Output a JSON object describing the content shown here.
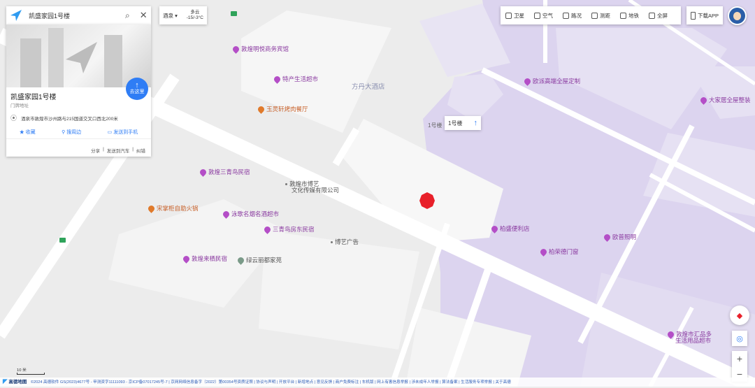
{
  "search": {
    "value": "凯盛家园1号楼"
  },
  "weather": {
    "city": "酒泉",
    "condition": "多云",
    "temp": "-15/-3°C"
  },
  "toolbar": {
    "items": [
      {
        "label": "卫星",
        "icon": "satellite-icon"
      },
      {
        "label": "空气",
        "icon": "air-icon"
      },
      {
        "label": "路况",
        "icon": "traffic-light-icon"
      },
      {
        "label": "测距",
        "icon": "ruler-icon"
      },
      {
        "label": "地铁",
        "icon": "subway-icon"
      },
      {
        "label": "全屏",
        "icon": "fullscreen-icon"
      }
    ],
    "download": "下载APP"
  },
  "place": {
    "name": "凯盛家园1号楼",
    "type": "门牌地址",
    "address": "酒泉市敦煌市沙州路与215国道交叉口西北200米",
    "go_label": "去这里",
    "actions": [
      "收藏",
      "搜周边",
      "发送到手机"
    ],
    "links": [
      "分享",
      "发送到汽车",
      "纠错"
    ]
  },
  "marker_label": "1号楼",
  "building_label": "1号楼",
  "pois": [
    {
      "name": "敦煌明悦商务宾馆",
      "kind": "purple"
    },
    {
      "name": "特产生活超市",
      "kind": "purple"
    },
    {
      "name": "玉灵轩烤肉餐厅",
      "kind": "orange"
    },
    {
      "name": "欧派高端全屋定制",
      "kind": "purple"
    },
    {
      "name": "大家居全屋整装",
      "kind": "purple"
    },
    {
      "name": "敦煌三青鸟民宿",
      "kind": "purple"
    },
    {
      "name": "敦煌市博艺",
      "kind": "dot"
    },
    {
      "name": "文化传媒有限公司",
      "kind": "text"
    },
    {
      "name": "宋掌柜自助火锅",
      "kind": "orange"
    },
    {
      "name": "泳歌名烟名酒超市",
      "kind": "purple"
    },
    {
      "name": "三青鸟房东民宿",
      "kind": "purple"
    },
    {
      "name": "博艺广告",
      "kind": "dot"
    },
    {
      "name": "柏盛便利店",
      "kind": "purple"
    },
    {
      "name": "欧普照明",
      "kind": "purple"
    },
    {
      "name": "柏荣德门窗",
      "kind": "purple"
    },
    {
      "name": "敦煌来栖民宿",
      "kind": "purple"
    },
    {
      "name": "绿云丽都家苑",
      "kind": "gray"
    },
    {
      "name": "敦煌市汇品多",
      "kind": "purple"
    },
    {
      "name": "生活用品超市",
      "kind": "text"
    }
  ],
  "area_label": "方丹大酒店",
  "scale": "10 米",
  "logo": "高德地图",
  "copyright": "©2024 高德软件 GS(2023)4677号 - 甲测资字11111093 - 京ICP备07017245号-7 | 京网网络信息备字（2022）第00354号资质证照 | 协议与声明 | 开放平台 | 新增地点 | 意见反馈 | 商户免费标注 | 车机版 | 网上有害信息举报 | 涉未成年人举报 | 算法备案 | 生活服务专项举报 | 关于高德",
  "colors": {
    "building_purple": "#d9d2ee",
    "marker_red": "#e8202a",
    "blue": "#2f7df5"
  }
}
